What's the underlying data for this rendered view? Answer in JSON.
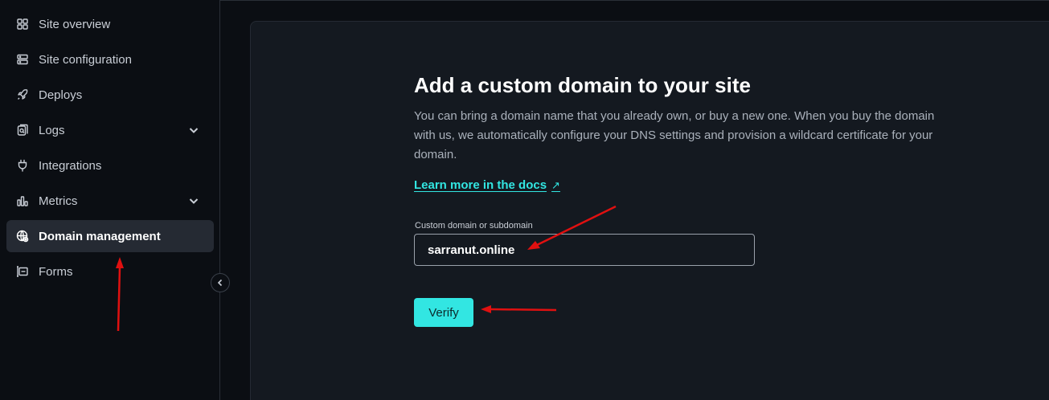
{
  "sidebar": {
    "items": [
      {
        "label": "Site overview",
        "icon": "grid-icon",
        "chevron": false,
        "active": false
      },
      {
        "label": "Site configuration",
        "icon": "server-icon",
        "chevron": false,
        "active": false
      },
      {
        "label": "Deploys",
        "icon": "rocket-icon",
        "chevron": false,
        "active": false
      },
      {
        "label": "Logs",
        "icon": "logs-icon",
        "chevron": true,
        "active": false
      },
      {
        "label": "Integrations",
        "icon": "plug-icon",
        "chevron": false,
        "active": false
      },
      {
        "label": "Metrics",
        "icon": "chart-icon",
        "chevron": true,
        "active": false
      },
      {
        "label": "Domain management",
        "icon": "globe-gear-icon",
        "chevron": false,
        "active": true
      },
      {
        "label": "Forms",
        "icon": "form-icon",
        "chevron": false,
        "active": false
      }
    ]
  },
  "main": {
    "title": "Add a custom domain to your site",
    "description": "You can bring a domain name that you already own, or buy a new one. When you buy the domain with us, we automatically configure your DNS settings and provision a wildcard certificate for your domain.",
    "docs_link": "Learn more in the docs",
    "docs_link_icon": "↗",
    "field_label": "Custom domain or subdomain",
    "field_value": "sarranut.online",
    "verify_label": "Verify"
  },
  "colors": {
    "accent": "#32e6e2",
    "background": "#0b0e13",
    "panel": "#141920",
    "annotation": "#e01010"
  }
}
